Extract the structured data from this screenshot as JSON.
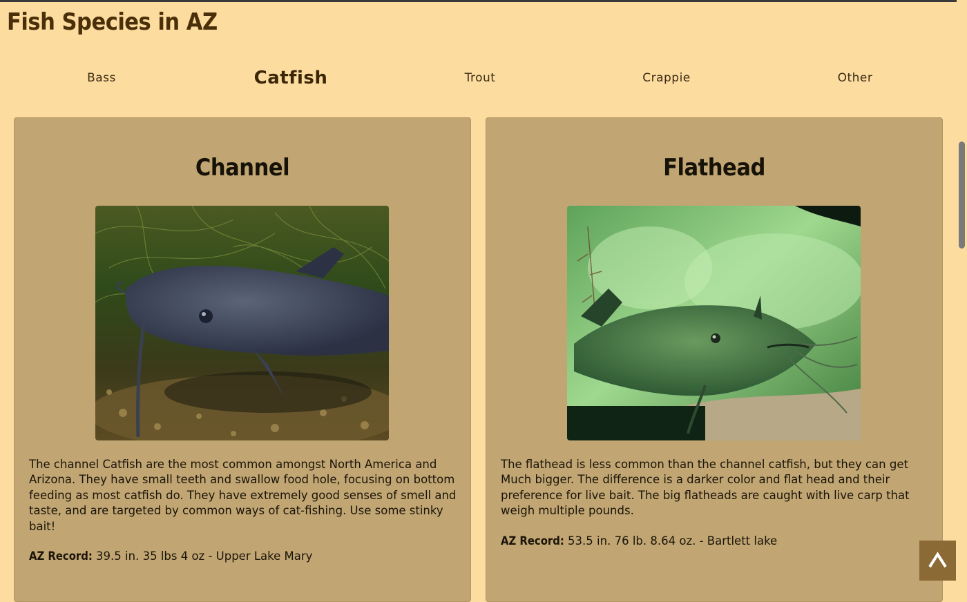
{
  "page": {
    "title": "Fish Species in AZ"
  },
  "nav": {
    "items": [
      {
        "label": "Bass",
        "active": false
      },
      {
        "label": "Catfish",
        "active": true
      },
      {
        "label": "Trout",
        "active": false
      },
      {
        "label": "Crappie",
        "active": false
      },
      {
        "label": "Other",
        "active": false
      }
    ]
  },
  "cards": [
    {
      "title": "Channel",
      "image_icon": "channel-catfish-photo",
      "description": "The channel Catfish are the most common amongst North America and Arizona. They have small teeth and swallow food hole, focusing on bottom feeding as most catfish do. They have extremely good senses of smell and taste, and are targeted by common ways of cat-fishing. Use some stinky bait!",
      "record_label": "AZ Record:",
      "record_value": " 39.5 in. 35 lbs 4 oz - Upper Lake Mary"
    },
    {
      "title": "Flathead",
      "image_icon": "flathead-catfish-photo",
      "description": "The flathead is less common than the channel catfish, but they can get Much bigger. The difference is a darker color and flat head and their preference for live bait. The big flatheads are caught with live carp that weigh multiple pounds.",
      "record_label": "AZ Record:",
      "record_value": " 53.5 in. 76 lb. 8.64 oz. - Bartlett lake"
    }
  ],
  "back_to_top": {
    "icon": "chevron-up-icon"
  },
  "colors": {
    "background": "#fddc9f",
    "card": "#c1a674",
    "title": "#4a300a",
    "top_button": "#8b6a36"
  }
}
